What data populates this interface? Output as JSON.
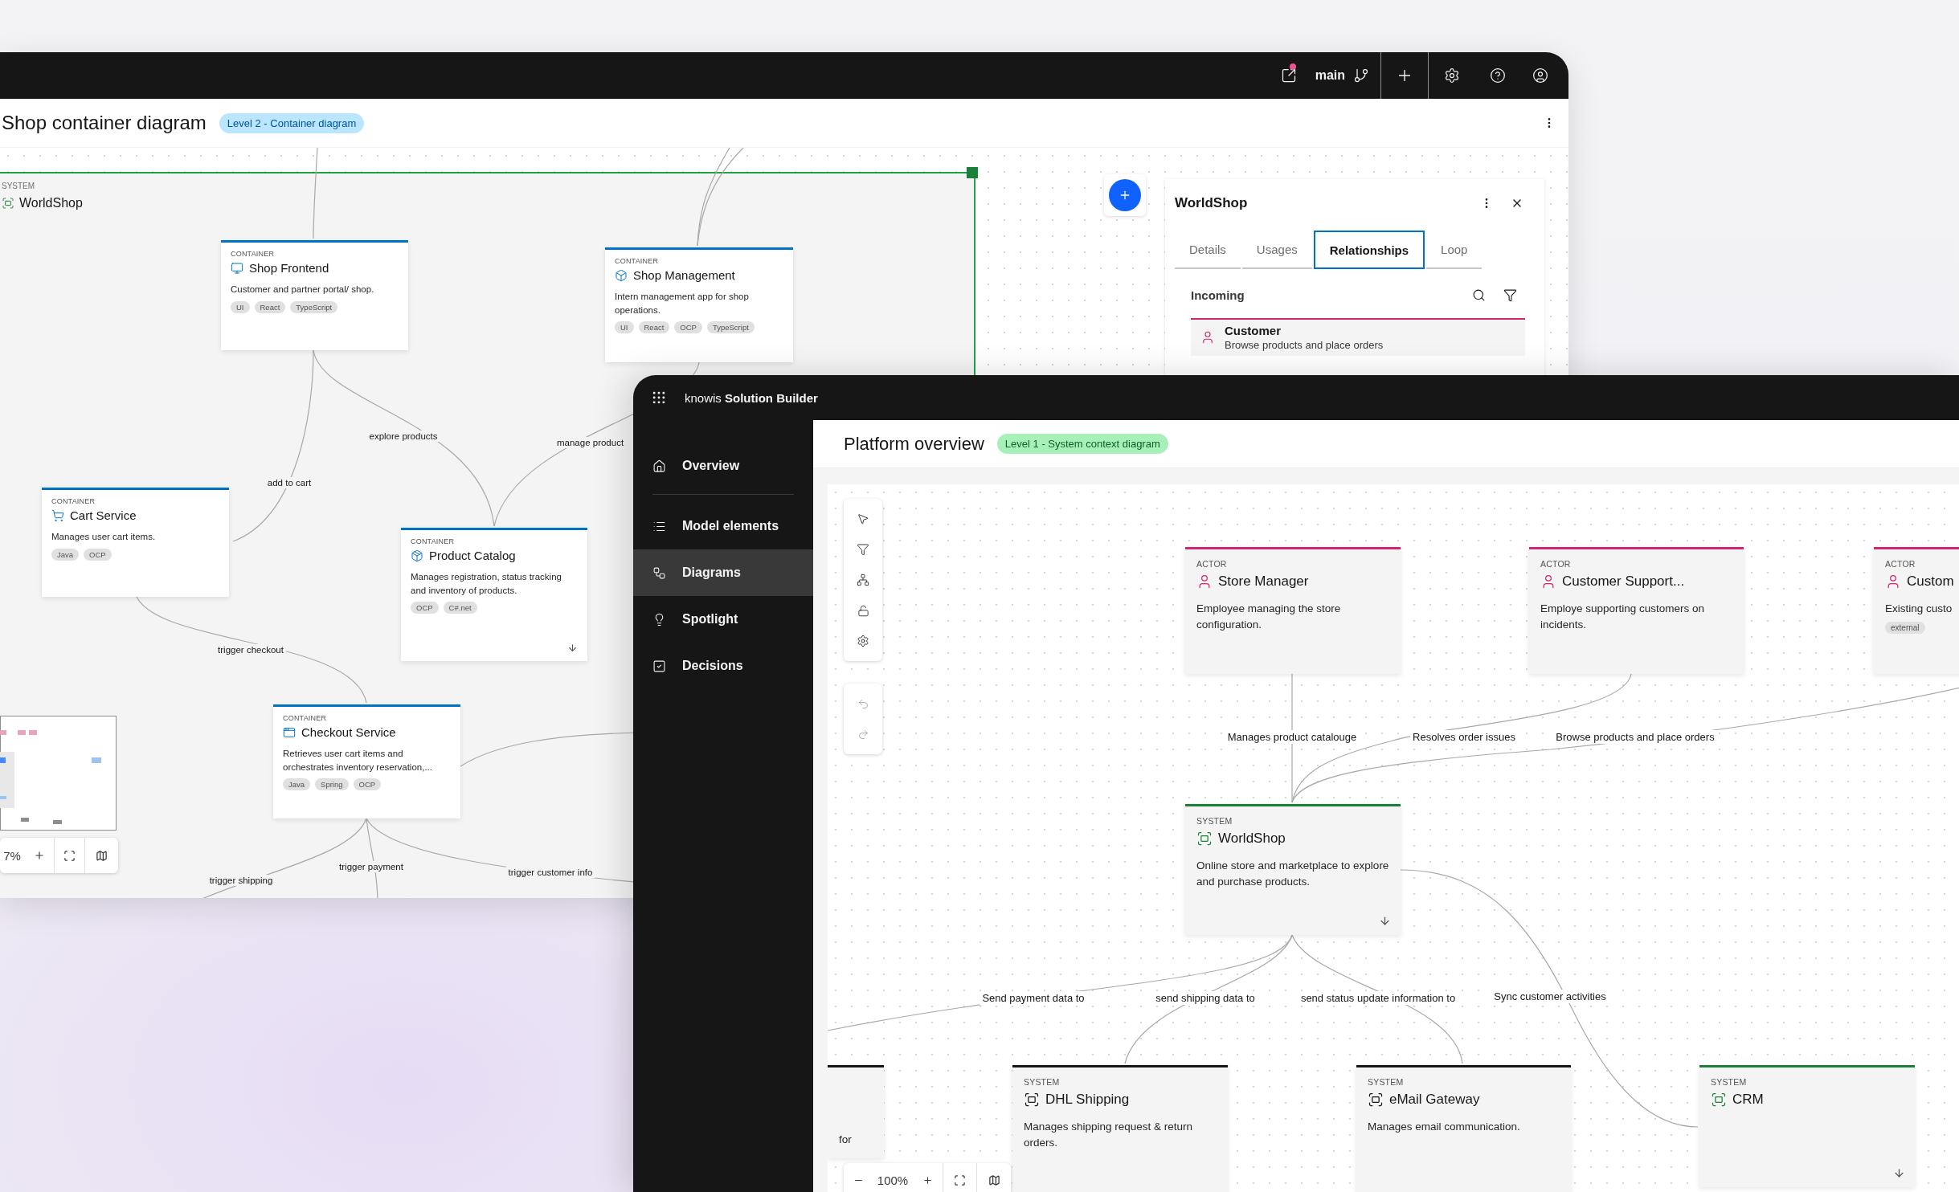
{
  "back_window": {
    "toolbar": {
      "share_notification": true,
      "branch": "main"
    },
    "title": "Shop container diagram",
    "badge": "Level 2 - Container diagram",
    "boundary": {
      "type_label": "SYSTEM",
      "name": "WorldShop"
    },
    "nodes": [
      {
        "kind": "container",
        "type_label": "CONTAINER",
        "name": "Shop Frontend",
        "description": "Customer and partner portal/ shop.",
        "tags": [
          "UI",
          "React",
          "TypeScript"
        ],
        "expandable": false
      },
      {
        "kind": "container",
        "type_label": "CONTAINER",
        "name": "Shop Management",
        "description": "Intern management app for shop operations.",
        "tags": [
          "UI",
          "React",
          "OCP",
          "TypeScript"
        ],
        "expandable": false
      },
      {
        "kind": "container",
        "type_label": "CONTAINER",
        "name": "Cart Service",
        "description": "Manages user cart items.",
        "tags": [
          "Java",
          "OCP"
        ],
        "expandable": false
      },
      {
        "kind": "container",
        "type_label": "CONTAINER",
        "name": "Product Catalog",
        "description": "Manages registration, status tracking and inventory of products.",
        "tags": [
          "OCP",
          "C#.net"
        ],
        "expandable": true
      },
      {
        "kind": "container",
        "type_label": "CONTAINER",
        "name": "Checkout Service",
        "description": "Retrieves user cart items and orchestrates inventory reservation,...",
        "tags": [
          "Java",
          "Spring",
          "OCP"
        ],
        "expandable": false
      }
    ],
    "edge_labels": [
      "explore products",
      "manage product",
      "add to cart",
      "trigger checkout",
      "trigger shipping",
      "trigger payment",
      "trigger customer info"
    ],
    "zoom": "7%",
    "panel": {
      "title": "WorldShop",
      "tabs": [
        {
          "label": "Details",
          "selected": false
        },
        {
          "label": "Usages",
          "selected": false
        },
        {
          "label": "Relationships",
          "selected": true
        },
        {
          "label": "Loop",
          "selected": false
        }
      ],
      "section": "Incoming",
      "relations": [
        {
          "name": "Customer",
          "description": "Browse products and place orders"
        }
      ]
    }
  },
  "front_window": {
    "app_name": "knowis **Solution Builder**",
    "sidebar": [
      {
        "label": "Overview",
        "selected": false
      },
      {
        "label": "Model elements",
        "selected": false
      },
      {
        "label": "Diagrams",
        "selected": true
      },
      {
        "label": "Spotlight",
        "selected": false
      },
      {
        "label": "Decisions",
        "selected": false
      }
    ],
    "title": "Platform overview",
    "badge": "Level 1 - System context diagram",
    "history": {
      "undo_disabled": true,
      "redo_disabled": true
    },
    "nodes": [
      {
        "kind": "actor",
        "type_label": "ACTOR",
        "name": "Store Manager",
        "description": "Employee managing the store configuration.",
        "expandable": false
      },
      {
        "kind": "actor",
        "type_label": "ACTOR",
        "name": "Customer Support...",
        "description": "Employe supporting customers on incidents.",
        "expandable": false
      },
      {
        "kind": "actor",
        "type_label": "ACTOR",
        "name": "Custom",
        "description": "Existing custo",
        "tags": [
          "external"
        ],
        "expandable": false
      },
      {
        "kind": "system",
        "color": "#198038",
        "type_label": "SYSTEM",
        "name": "WorldShop",
        "description": "Online store and marketplace to explore and purchase products.",
        "expandable": true
      },
      {
        "kind": "system",
        "color": "#161616",
        "description": "for",
        "expandable": false
      },
      {
        "kind": "system",
        "color": "#161616",
        "type_label": "SYSTEM",
        "name": "DHL Shipping",
        "description": "Manages shipping request & return orders.",
        "expandable": false
      },
      {
        "kind": "system",
        "color": "#161616",
        "type_label": "SYSTEM",
        "name": "eMail Gateway",
        "description": "Manages email communication.",
        "expandable": false
      },
      {
        "kind": "system",
        "color": "#198038",
        "type_label": "SYSTEM",
        "name": "CRM",
        "expandable": true
      }
    ],
    "edge_labels": [
      "Manages product catalouge",
      "Resolves order issues",
      "Browse products and place orders",
      "Send payment data to",
      "send shipping data to",
      "send status update information to",
      "Sync customer activities"
    ],
    "zoom": "100%"
  }
}
